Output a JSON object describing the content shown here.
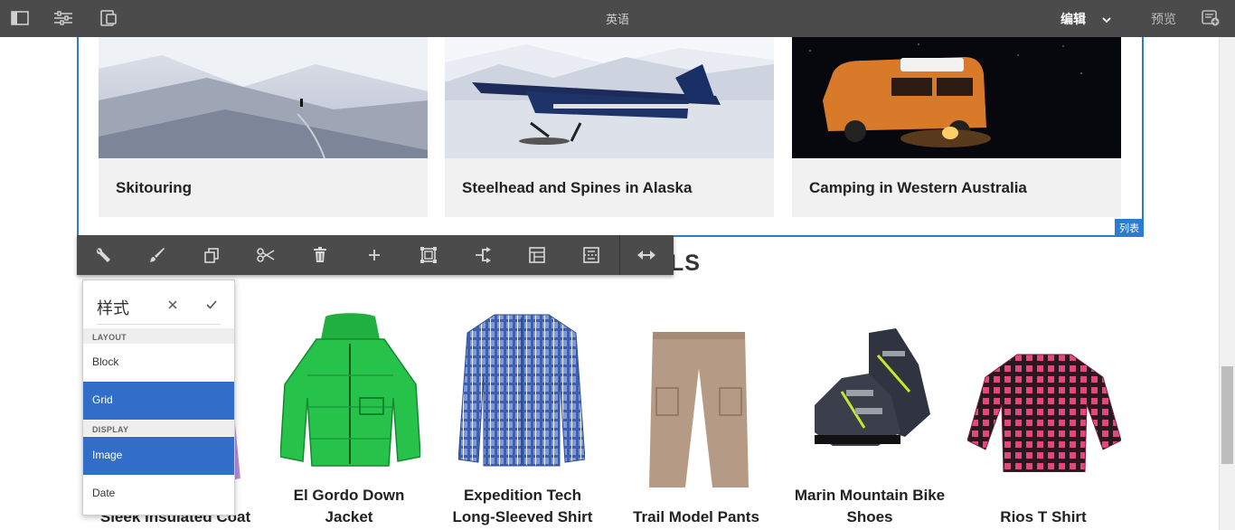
{
  "topbar": {
    "title": "英语",
    "mode_label": "编辑",
    "preview_label": "预览",
    "icons": [
      "side-panel-icon",
      "page-properties-icon",
      "emulator-icon",
      "chevron-down-icon",
      "annotations-icon"
    ]
  },
  "list_component": {
    "tag": "列表",
    "cards": [
      {
        "title": "Skitouring"
      },
      {
        "title": "Steelhead and Spines in Alaska"
      },
      {
        "title": "Camping in Western Australia"
      }
    ]
  },
  "section_heading_fragment": "LS",
  "toolbar": {
    "buttons": [
      "configure",
      "style",
      "copy",
      "cut",
      "delete",
      "insert",
      "group",
      "parent",
      "layout",
      "template",
      "layout-resize"
    ]
  },
  "style_popover": {
    "title": "样式",
    "groups": [
      {
        "label": "LAYOUT",
        "options": [
          {
            "label": "Block",
            "selected": false
          },
          {
            "label": "Grid",
            "selected": true
          }
        ]
      },
      {
        "label": "DISPLAY",
        "options": [
          {
            "label": "Image",
            "selected": true
          },
          {
            "label": "Date",
            "selected": false
          }
        ]
      }
    ]
  },
  "products": [
    {
      "line1": "Sleek Insulated Coat",
      "line2": ""
    },
    {
      "line1": "El Gordo Down",
      "line2": "Jacket"
    },
    {
      "line1": "Expedition Tech",
      "line2": "Long-Sleeved Shirt"
    },
    {
      "line1": "Trail Model Pants",
      "line2": ""
    },
    {
      "line1": "Marin Mountain Bike",
      "line2": "Shoes"
    },
    {
      "line1": "Rios T Shirt",
      "line2": ""
    }
  ],
  "colors": {
    "accent_blue": "#2d7bd0",
    "selected_option": "#326ec8",
    "topbar": "#4b4b4b"
  }
}
